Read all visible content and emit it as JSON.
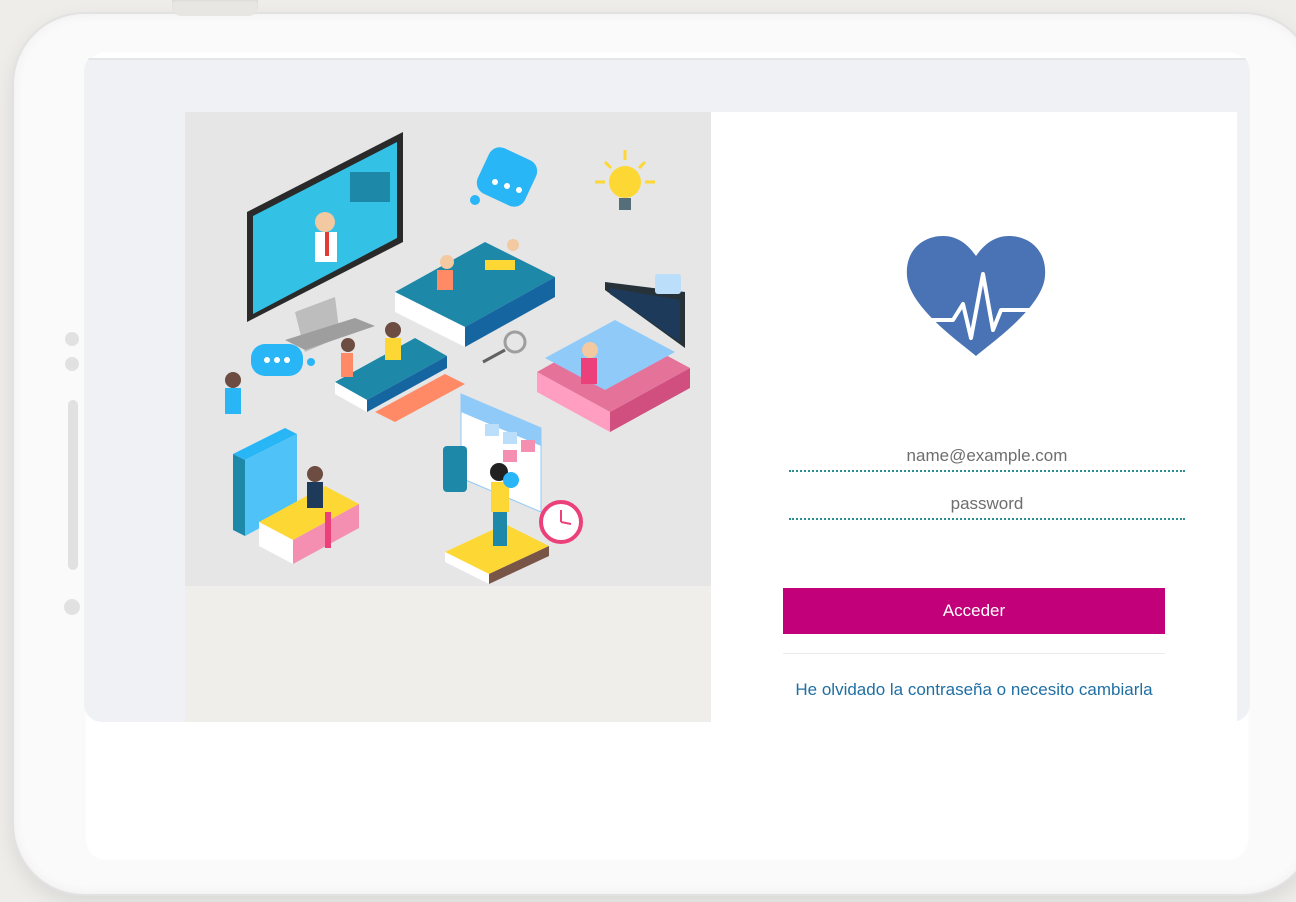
{
  "login": {
    "email_placeholder": "name@example.com",
    "password_placeholder": "password",
    "submit_label": "Acceder",
    "forgot_link": "He olvidado la contraseña o necesito cambiarla"
  },
  "icons": {
    "logo": "heart-pulse-icon",
    "illustration": "online-education-illustration"
  },
  "colors": {
    "accent_button": "#c2007a",
    "logo_blue": "#4a73b5",
    "link_blue": "#1f6fa3",
    "input_underline": "#2b8f8f"
  }
}
